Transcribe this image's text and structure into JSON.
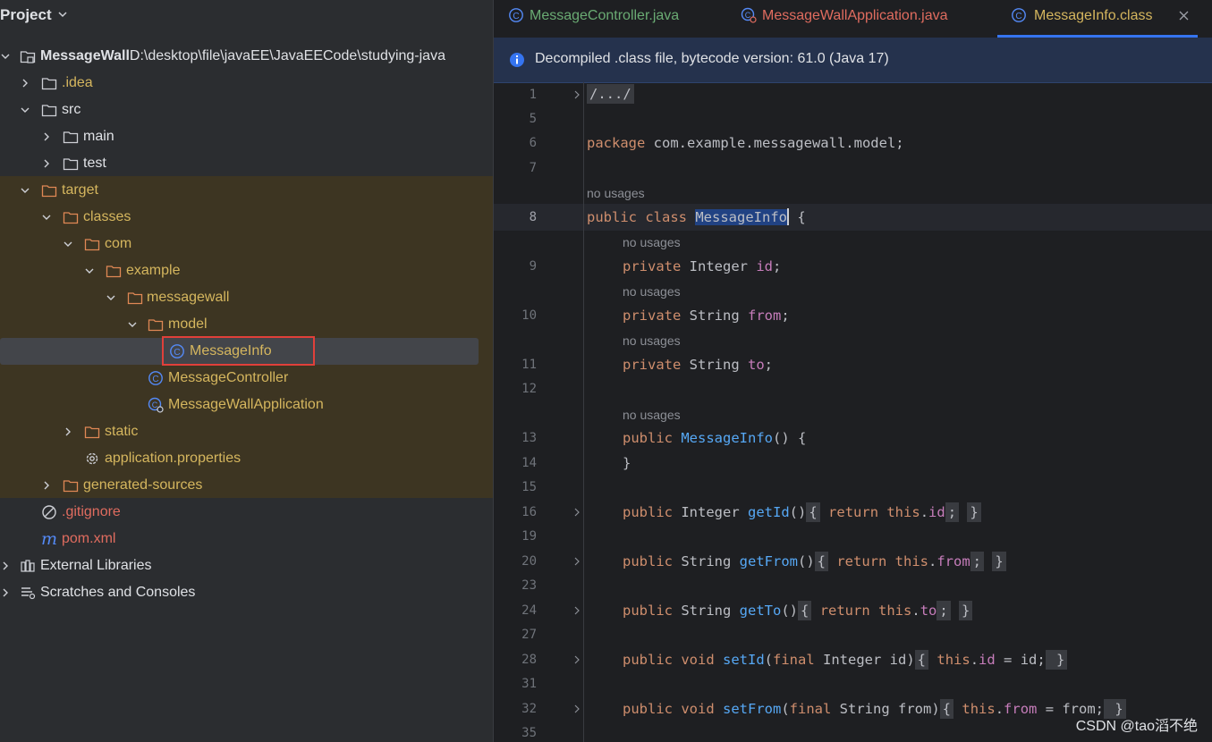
{
  "project": {
    "title": "Project",
    "tree": [
      {
        "label": "MessageWall",
        "path": "D:\\desktop\\file\\javaEE\\JavaEECode\\studying-java"
      },
      {
        "label": ".idea"
      },
      {
        "label": "src"
      },
      {
        "label": "main"
      },
      {
        "label": "test"
      },
      {
        "label": "target"
      },
      {
        "label": "classes"
      },
      {
        "label": "com"
      },
      {
        "label": "example"
      },
      {
        "label": "messagewall"
      },
      {
        "label": "model"
      },
      {
        "label": "MessageInfo"
      },
      {
        "label": "MessageController"
      },
      {
        "label": "MessageWallApplication"
      },
      {
        "label": "static"
      },
      {
        "label": "application.properties"
      },
      {
        "label": "generated-sources"
      },
      {
        "label": ".gitignore"
      },
      {
        "label": "pom.xml"
      },
      {
        "label": "External Libraries"
      },
      {
        "label": "Scratches and Consoles"
      }
    ]
  },
  "editor": {
    "tabs": [
      {
        "label": "MessageController.java"
      },
      {
        "label": "MessageWallApplication.java"
      },
      {
        "label": "MessageInfo.class"
      }
    ],
    "banner": "Decompiled .class file, bytecode version: 61.0 (Java 17)",
    "hint": "no usages",
    "line_numbers": [
      "1",
      "5",
      "6",
      "7",
      "8",
      "9",
      "10",
      "11",
      "12",
      "13",
      "14",
      "15",
      "16",
      "19",
      "20",
      "23",
      "24",
      "27",
      "28",
      "31",
      "32",
      "35"
    ],
    "code": {
      "l1": "/.../",
      "l6_kw": "package",
      "l6_rest": " com.example.messagewall.model;",
      "l8_kw": "public class",
      "l8_name": "MessageInfo",
      "l8_rest": "{",
      "l9_kw": "private",
      "l9_type": " Integer ",
      "l9_field": "id",
      "l10_kw": "private",
      "l10_type": " String ",
      "l10_field": "from",
      "l11_kw": "private",
      "l11_type": " String ",
      "l11_field": "to",
      "l13_kw": "public",
      "l13_fn": "MessageInfo",
      "l13_rest": "() {",
      "l14": "}",
      "l16_kw": "public",
      "l16_type": " Integer ",
      "l16_fn": "getId",
      "l16_paren": "()",
      "l16_body_kw": "return this",
      "l16_body_fld": "id",
      "l20_kw": "public",
      "l20_type": " String ",
      "l20_fn": "getFrom",
      "l20_paren": "()",
      "l20_body_kw": "return this",
      "l20_body_fld": "from",
      "l24_kw": "public",
      "l24_type": " String ",
      "l24_fn": "getTo",
      "l24_paren": "()",
      "l24_body_kw": "return this",
      "l24_body_fld": "to",
      "l28_kw": "public void",
      "l28_fn": "setId",
      "l28_param_kw": "final",
      "l28_param": " Integer id)",
      "l28_body_kw": "this",
      "l28_body_fld": "id",
      "l28_body_rest": " = id;",
      "l32_kw": "public void",
      "l32_fn": "setFrom",
      "l32_param_kw": "final",
      "l32_param": " String from)",
      "l32_body_kw": "this",
      "l32_body_fld": "from",
      "l32_body_rest": " = from;"
    }
  },
  "watermark": "CSDN @tao滔不绝",
  "colors": {
    "keyword": "#cf8e6d",
    "field": "#c77dbb",
    "function": "#56a8f5",
    "excluded": "#d5b65e",
    "ignored": "#e06c5f",
    "accent": "#3574f0"
  }
}
